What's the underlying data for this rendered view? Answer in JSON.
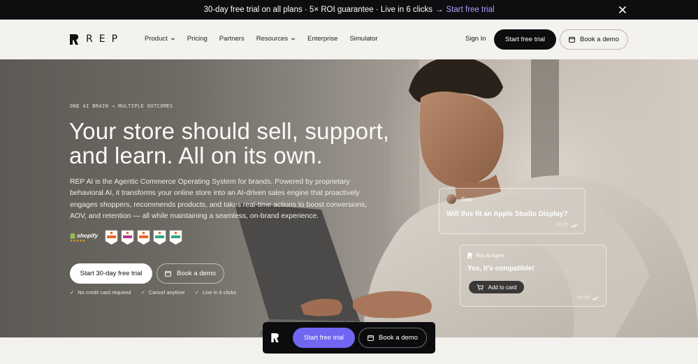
{
  "announcement": {
    "text": "30-day free trial on all plans · 5× ROI guarantee · Live in 6 clicks",
    "arrow": "→",
    "link": "Start free trial",
    "close_icon": "close-icon"
  },
  "nav": {
    "logo_text": "REP",
    "items": [
      {
        "label": "Product",
        "has_dropdown": true
      },
      {
        "label": "Pricing",
        "has_dropdown": false
      },
      {
        "label": "Partners",
        "has_dropdown": false
      },
      {
        "label": "Resources",
        "has_dropdown": true
      },
      {
        "label": "Enterprise",
        "has_dropdown": false
      },
      {
        "label": "Simulator",
        "has_dropdown": false
      }
    ],
    "sign_in": "Sign In",
    "trial_button": "Start free trial",
    "demo_button": "Book a demo"
  },
  "hero": {
    "eyebrow": "ONE AI BRAIN → MULTIPLE OUTCOMES",
    "headline_line1": "Your store should sell, support,",
    "headline_line2": "and learn. All on its own.",
    "paragraph": "REP AI is the Agentic Commerce Operating System for brands. Powered by proprietary behavioral AI, it transforms your online store into an AI-driven sales engine that proactively engages shoppers, recommends products, and takes real-time actions to boost conversions, AOV, and retention — all while maintaining a seamless, on-brand experience.",
    "shopify_label": "shopify",
    "shopify_stars": "★★★★★",
    "badges": [
      {
        "title": "High Performer",
        "color": "#e8672c"
      },
      {
        "title": "High Performer",
        "color": "#b13a8a"
      },
      {
        "title": "Momentum Leader",
        "color": "#e8672c"
      },
      {
        "title": "Best Support",
        "color": "#2ea77f"
      },
      {
        "title": "Best Support",
        "color": "#2ea77f"
      }
    ],
    "trial_button": "Start 30-day free trial",
    "demo_button": "Book a demo",
    "checks": [
      "No credit card required",
      "Cancel anytime",
      "Live in 6 clicks"
    ]
  },
  "chat": {
    "user_name": "Sam",
    "question": "Will this fit an Apple Studio Display?",
    "question_time": "10:25",
    "agent_name": "Rep AI Agent",
    "answer": "Yes, it's compatible!",
    "add_button": "Add to card",
    "answer_time": "10:25"
  },
  "sticky": {
    "trial_button": "Start free trial",
    "demo_button": "Book a demo"
  }
}
